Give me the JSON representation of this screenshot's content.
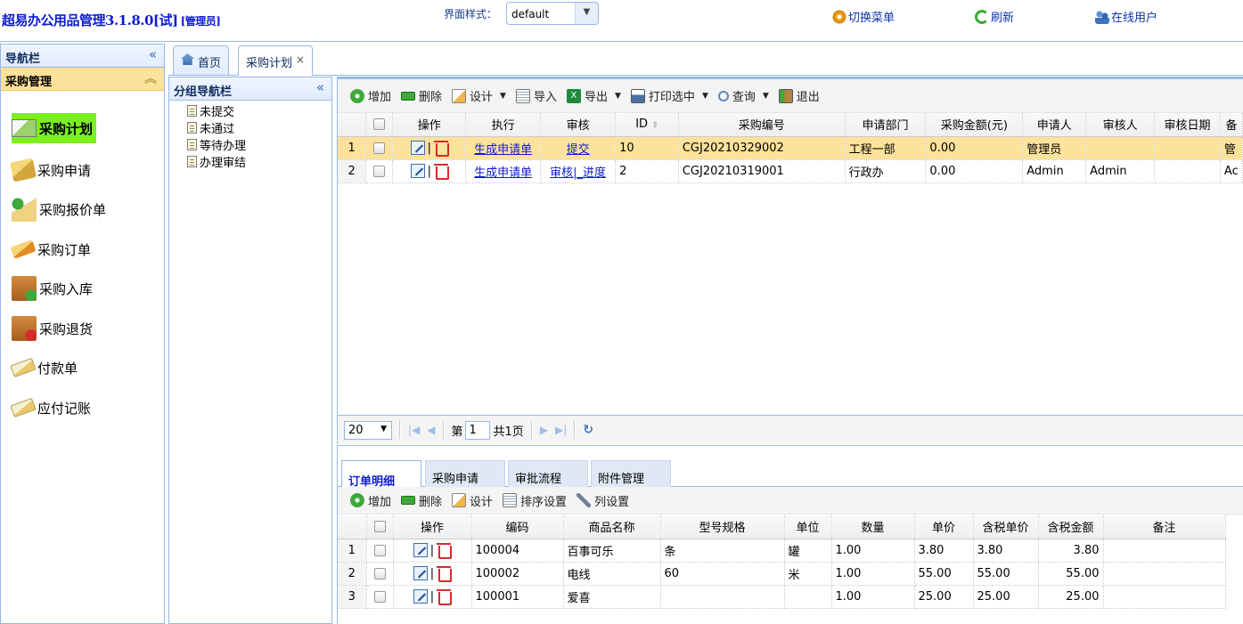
{
  "header": {
    "app_title": "超易办公用品管理3.1.8.0[试]",
    "role": "[管理员]",
    "skin_label": "界面样式：",
    "skin_value": "default",
    "switch_menu": "切换菜单",
    "refresh": "刷新",
    "online_users": "在线用户"
  },
  "nav": {
    "title": "导航栏",
    "section": "采购管理",
    "items": [
      "采购计划",
      "采购申请",
      "采购报价单",
      "采购订单",
      "采购入库",
      "采购退货",
      "付款单",
      "应付记账"
    ]
  },
  "tabs": {
    "home": "首页",
    "current": "采购计划",
    "close": "×"
  },
  "group_nav": {
    "title": "分组导航栏",
    "items": [
      "未提交",
      "未通过",
      "等待办理",
      "办理审结"
    ]
  },
  "toolbar": {
    "add": "增加",
    "delete": "删除",
    "design": "设计",
    "import": "导入",
    "export": "导出",
    "print": "打印选中",
    "query": "查询",
    "exit": "退出"
  },
  "grid": {
    "headers": [
      "操作",
      "执行",
      "审核",
      "ID",
      "采购编号",
      "申请部门",
      "采购金额(元)",
      "申请人",
      "审核人",
      "审核日期",
      "备"
    ],
    "rows": [
      {
        "num": "1",
        "exec": "生成申请单",
        "audit": "提交",
        "id": "10",
        "code": "CGJ20210329002",
        "dept": "工程一部",
        "amount": "0.00",
        "applicant": "管理员",
        "auditor": "",
        "audit_date": "",
        "extra": "管"
      },
      {
        "num": "2",
        "exec": "生成申请单",
        "audit": "审核|_进度",
        "id": "2",
        "code": "CGJ20210319001",
        "dept": "行政办",
        "amount": "0.00",
        "applicant": "Admin",
        "auditor": "Admin",
        "audit_date": "",
        "extra": "Ac"
      }
    ]
  },
  "pager": {
    "size": "20",
    "page_prefix": "第",
    "page": "1",
    "total": "共1页"
  },
  "lower": {
    "tabs": [
      "订单明细",
      "采购申请",
      "审批流程",
      "附件管理"
    ],
    "toolbar": {
      "add": "增加",
      "delete": "删除",
      "design": "设计",
      "sort": "排序设置",
      "columns": "列设置"
    },
    "headers": [
      "操作",
      "编码",
      "商品名称",
      "型号规格",
      "单位",
      "数量",
      "单价",
      "含税单价",
      "含税金额",
      "备注"
    ],
    "rows": [
      {
        "num": "1",
        "code": "100004",
        "name": "百事可乐",
        "spec": "条",
        "unit": "罐",
        "qty": "1.00",
        "price": "3.80",
        "tax_price": "3.80",
        "tax_amount": "3.80",
        "note": ""
      },
      {
        "num": "2",
        "code": "100002",
        "name": "电线",
        "spec": "60",
        "unit": "米",
        "qty": "1.00",
        "price": "55.00",
        "tax_price": "55.00",
        "tax_amount": "55.00",
        "note": ""
      },
      {
        "num": "3",
        "code": "100001",
        "name": "爱喜",
        "spec": "",
        "unit": "",
        "qty": "1.00",
        "price": "25.00",
        "tax_price": "25.00",
        "tax_amount": "25.00",
        "note": ""
      }
    ]
  }
}
